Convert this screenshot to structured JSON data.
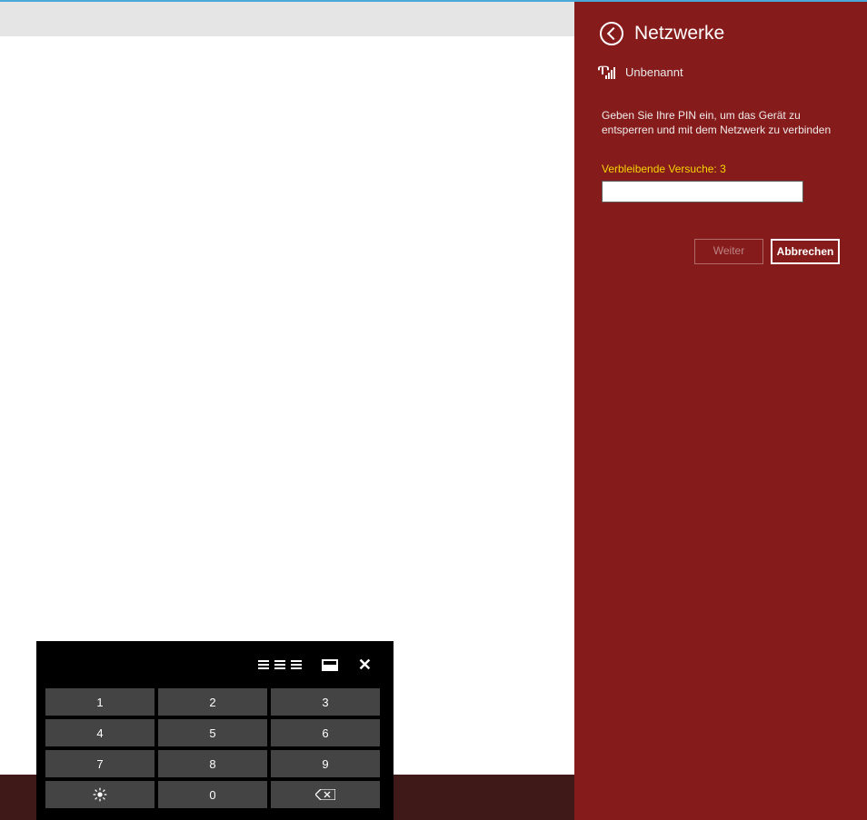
{
  "panel": {
    "title": "Netzwerke",
    "network_name": "Unbenannt",
    "instruction": "Geben Sie Ihre PIN ein, um das Gerät zu entsperren und mit dem Netzwerk zu verbinden",
    "attempts_label": "Verbleibende Versuche: 3",
    "pin_value": "",
    "next_label": "Weiter",
    "cancel_label": "Abbrechen"
  },
  "keypad": {
    "keys": [
      "1",
      "2",
      "3",
      "4",
      "5",
      "6",
      "7",
      "8",
      "9"
    ],
    "zero": "0"
  }
}
